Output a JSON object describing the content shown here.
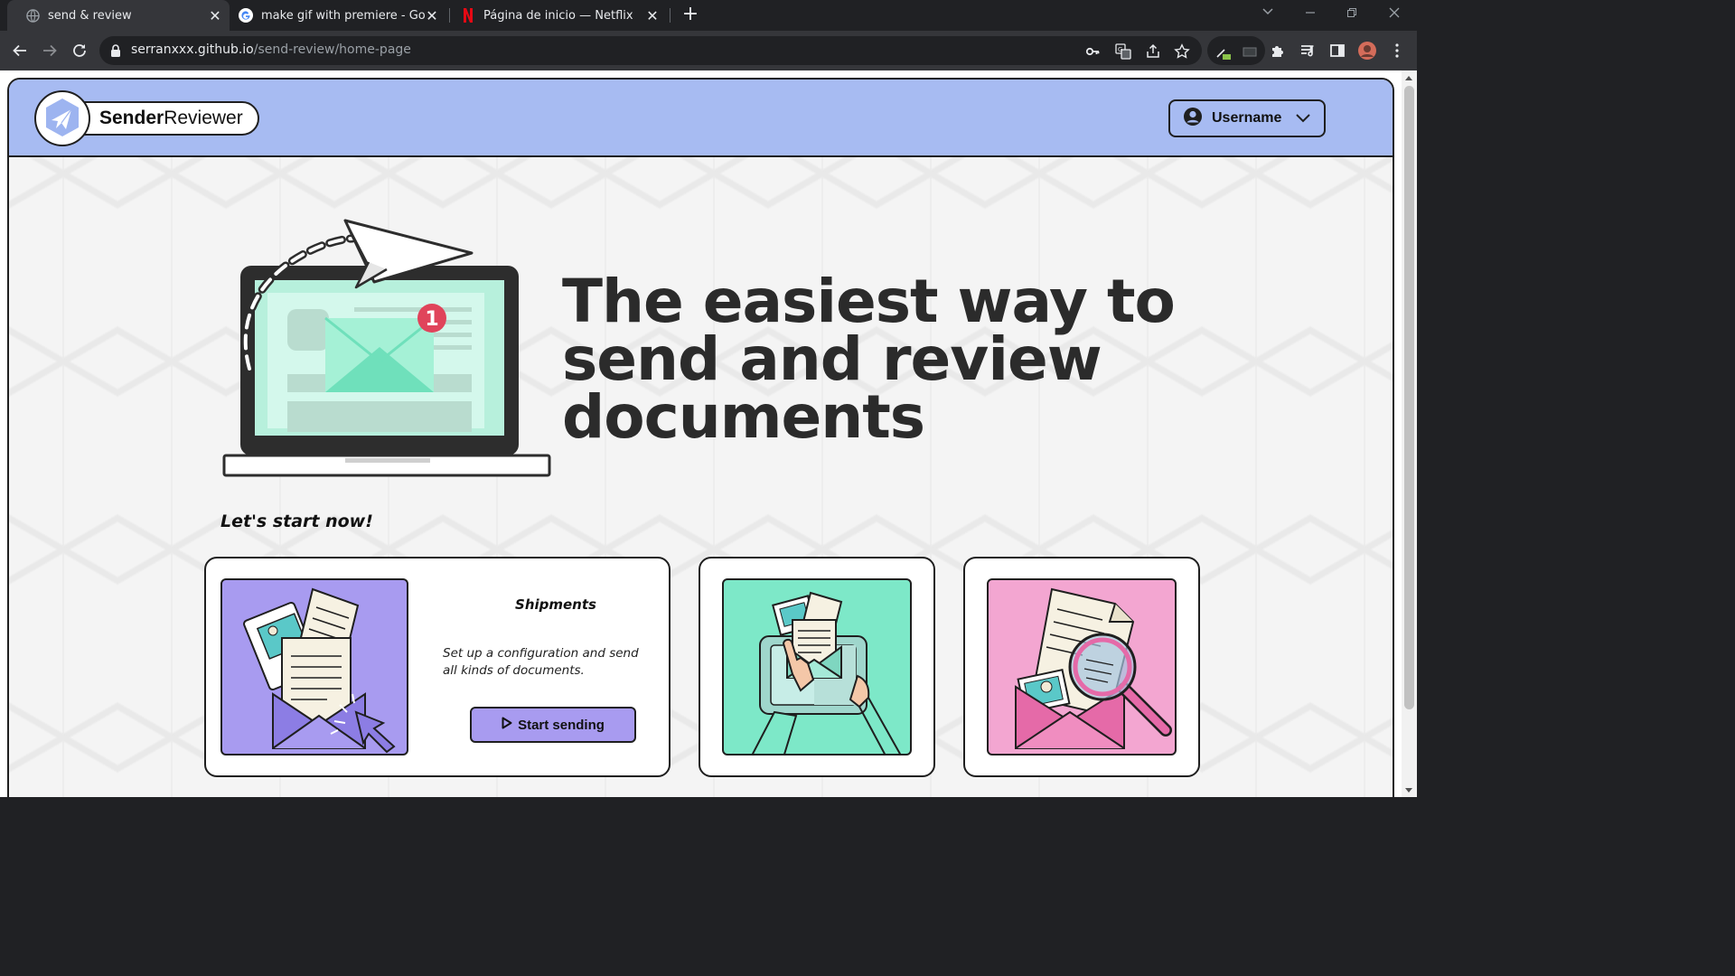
{
  "browser": {
    "tabs": [
      {
        "title": "send & review",
        "active": true,
        "favicon": "globe-icon"
      },
      {
        "title": "make gif with premiere - Google",
        "active": false,
        "favicon": "google-icon"
      },
      {
        "title": "Página de inicio — Netflix",
        "active": false,
        "favicon": "netflix-icon"
      }
    ],
    "url_host": "serranxxx.github.io",
    "url_path": "/send-review/home-page"
  },
  "app": {
    "brand": {
      "bold": "Sender",
      "regular": "Reviewer"
    },
    "user_menu": {
      "label": "Username"
    },
    "hero": {
      "line1": "The easiest way to",
      "line2": "send and review",
      "line3": "documents"
    },
    "cta_heading": "Let's start now!",
    "cards": [
      {
        "title": "Shipments",
        "description": "Set up a configuration and send all kinds of documents.",
        "button": "Start sending",
        "color": "#a89bf0"
      },
      {
        "color": "#7de8c8"
      },
      {
        "color": "#f3a6d1"
      }
    ],
    "colors": {
      "header": "#a7bbf2",
      "accent_purple": "#a89bf0",
      "accent_mint": "#7de8c8",
      "accent_pink": "#f3a6d1",
      "badge": "#e0445b"
    },
    "notification_count": "1"
  }
}
